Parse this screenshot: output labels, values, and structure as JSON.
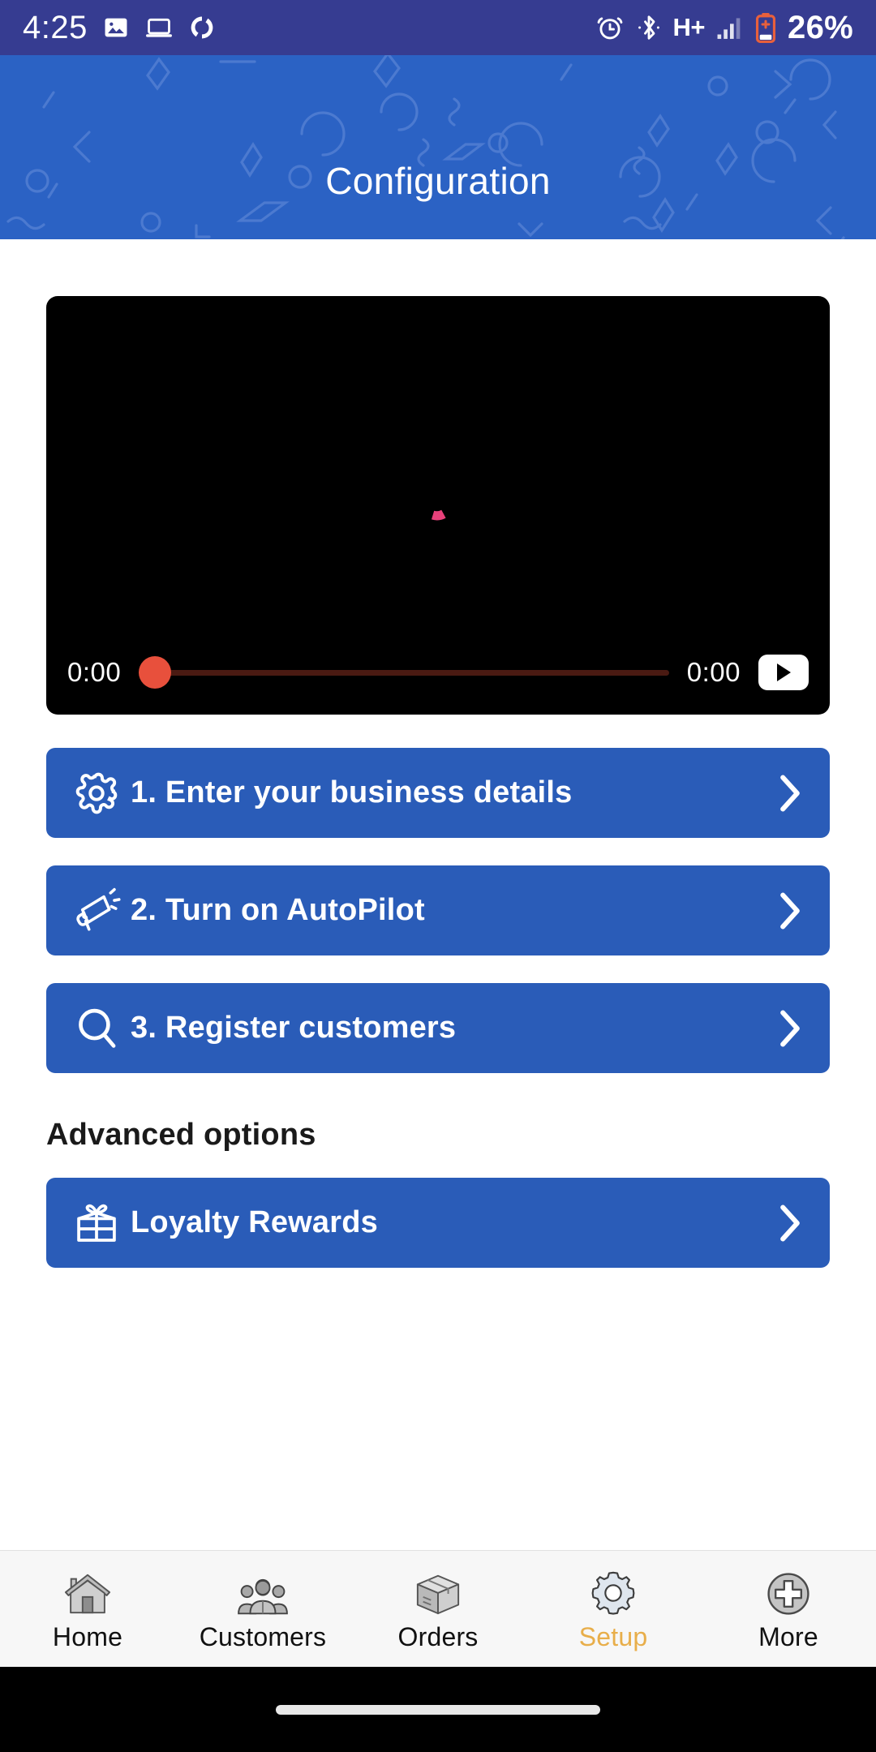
{
  "status_bar": {
    "time": "4:25",
    "battery_percent": "26%",
    "network_type": "H+",
    "icons": [
      "image-icon",
      "laptop-icon",
      "sync-icon",
      "alarm-icon",
      "bluetooth-icon",
      "signal-icon",
      "battery-charging-icon"
    ]
  },
  "header": {
    "title": "Configuration",
    "bg_color": "#2B62C4",
    "pattern_color": "#4C7AD0"
  },
  "video": {
    "current_time": "0:00",
    "duration": "0:00",
    "progress_percent": 0,
    "play_label": "play",
    "spinner_color": "#E8417A",
    "thumb_color": "#E8503C",
    "track_color": "#4a1a12"
  },
  "steps": [
    {
      "label": "1. Enter your business details",
      "icon": "gear-icon"
    },
    {
      "label": "2. Turn on AutoPilot",
      "icon": "megaphone-icon"
    },
    {
      "label": "3. Register customers",
      "icon": "search-icon"
    }
  ],
  "advanced": {
    "heading": "Advanced options",
    "items": [
      {
        "label": "Loyalty Rewards",
        "icon": "gift-icon"
      }
    ]
  },
  "button_color": "#2A5CB8",
  "bottom_nav": {
    "active": "Setup",
    "active_color": "#E8AE4A",
    "items": [
      {
        "label": "Home",
        "icon": "house-icon"
      },
      {
        "label": "Customers",
        "icon": "people-icon"
      },
      {
        "label": "Orders",
        "icon": "box-icon"
      },
      {
        "label": "Setup",
        "icon": "gear-icon"
      },
      {
        "label": "More",
        "icon": "plus-circle-icon"
      }
    ]
  }
}
